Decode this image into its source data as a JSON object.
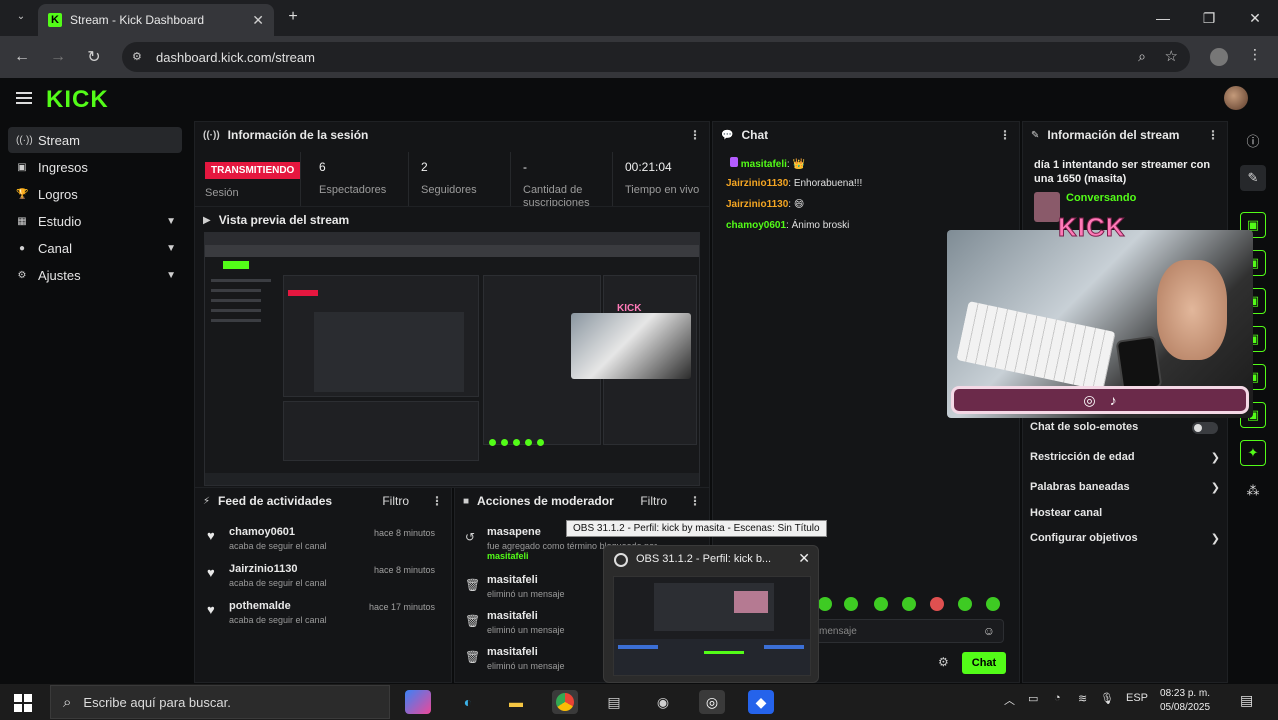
{
  "browser": {
    "tab_title": "Stream - Kick Dashboard",
    "url": "dashboard.kick.com/stream"
  },
  "kick": {
    "logo_text": "KICK"
  },
  "sidebar": {
    "items": [
      {
        "label": "Stream",
        "icon": "broadcast-icon"
      },
      {
        "label": "Ingresos",
        "icon": "wallet-icon"
      },
      {
        "label": "Logros",
        "icon": "trophy-icon"
      },
      {
        "label": "Estudio",
        "icon": "studio-icon"
      },
      {
        "label": "Canal",
        "icon": "person-icon"
      },
      {
        "label": "Ajustes",
        "icon": "gear-icon"
      }
    ]
  },
  "session": {
    "title": "Información de la sesión",
    "badge": "TRANSMITIENDO",
    "badge_label": "Sesión",
    "stats": [
      {
        "value": "6",
        "label": "Espectadores"
      },
      {
        "value": "2",
        "label": "Seguidores"
      },
      {
        "value": "-",
        "label": "Cantidad de suscripciones"
      },
      {
        "value": "00:21:04",
        "label": "Tiempo en vivo"
      }
    ]
  },
  "preview": {
    "title": "Vista previa del stream"
  },
  "feed": {
    "title": "Feed de actividades",
    "filter": "Filtro",
    "rows": [
      {
        "user": "chamoy0601",
        "sub": "acaba de seguir el canal",
        "time": "hace 8 minutos"
      },
      {
        "user": "Jairzinio1130",
        "sub": "acaba de seguir el canal",
        "time": "hace 8 minutos"
      },
      {
        "user": "pothemalde",
        "sub": "acaba de seguir el canal",
        "time": "hace 17 minutos"
      }
    ]
  },
  "mod": {
    "title": "Acciones de moderador",
    "filter": "Filtro",
    "rows": [
      {
        "user": "masapene",
        "sub": "fue agregado como término bloqueado por",
        "extra": "masitafeli"
      },
      {
        "user": "masitafeli",
        "sub": "eliminó un mensaje"
      },
      {
        "user": "masitafeli",
        "sub": "eliminó un mensaje"
      },
      {
        "user": "masitafeli",
        "sub": "eliminó un mensaje"
      }
    ]
  },
  "chat": {
    "title": "Chat",
    "messages": [
      {
        "user": "masitafeli",
        "text": "👑",
        "color": "#53fc18"
      },
      {
        "user": "Jairzinio1130",
        "text": "Enhorabuena!!!",
        "color": "#f5a623"
      },
      {
        "user": "Jairzinio1130",
        "text": "😄",
        "color": "#f5a623"
      },
      {
        "user": "chamoy0601",
        "text": "Ánimo broski",
        "color": "#53fc18"
      }
    ],
    "input_placeholder": "mensaje",
    "send_label": "Chat"
  },
  "stream_info": {
    "title": "Información del stream",
    "stream_title": "día 1 intentando ser streamer con una 1650 (masita)",
    "category": "Conversando",
    "settings": [
      {
        "label": "Chat de solo-emotes"
      },
      {
        "label": "Restricción de edad"
      },
      {
        "label": "Palabras baneadas"
      },
      {
        "label": "Hostear canal"
      },
      {
        "label": "Configurar objetivos"
      }
    ]
  },
  "overlay": {
    "logo_text": "KICK"
  },
  "tooltip": "OBS 31.1.2 - Perfil: kick by masita - Escenas: Sin Título",
  "obs_popup": {
    "title": "OBS 31.1.2 - Perfil: kick b..."
  },
  "taskbar": {
    "search_placeholder": "Escribe aquí para buscar.",
    "lang": "ESP",
    "time": "08:23 p. m.",
    "date": "05/08/2025"
  },
  "colors": {
    "kick_green": "#53fc18",
    "live_red": "#e5173f",
    "panel": "#141517"
  }
}
